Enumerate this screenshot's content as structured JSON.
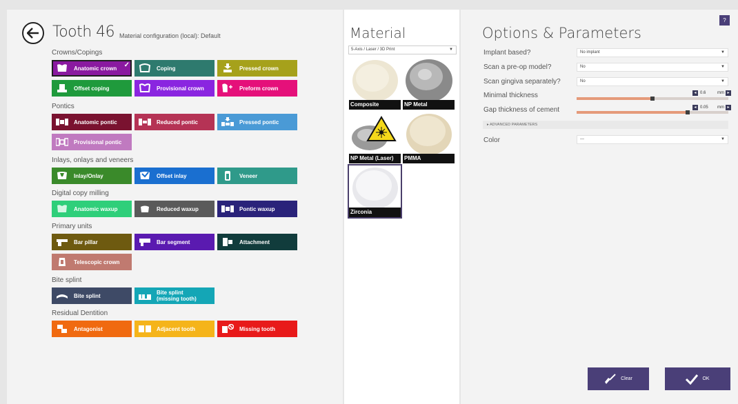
{
  "header": {
    "title": "Tooth 46",
    "subtitle": "Material configuration (local): Default"
  },
  "sections": [
    {
      "label": "Crowns/Copings"
    },
    {
      "label": "Pontics"
    },
    {
      "label": "Inlays, onlays and veneers"
    },
    {
      "label": "Digital copy milling"
    },
    {
      "label": "Primary units"
    },
    {
      "label": "Bite splint"
    },
    {
      "label": "Residual Dentition"
    }
  ],
  "tiles": {
    "anatomic_crown": {
      "label": "Anatomic crown",
      "color": "#8a1aa0"
    },
    "coping": {
      "label": "Coping",
      "color": "#2e7a6e"
    },
    "pressed_crown": {
      "label": "Pressed crown",
      "color": "#a6a11b"
    },
    "offset_coping": {
      "label": "Offset coping",
      "color": "#1f9a3c"
    },
    "provisional_crown": {
      "label": "Provisional crown",
      "color": "#8a25e0"
    },
    "preform_crown": {
      "label": "Preform crown",
      "color": "#e5107a"
    },
    "anatomic_pontic": {
      "label": "Anatomic pontic",
      "color": "#7a1230"
    },
    "reduced_pontic": {
      "label": "Reduced pontic",
      "color": "#b53355"
    },
    "pressed_pontic": {
      "label": "Pressed pontic",
      "color": "#4a9ad6"
    },
    "provisional_pontic": {
      "label": "Provisional pontic",
      "color": "#c07ac0"
    },
    "inlay_onlay": {
      "label": "Inlay/Onlay",
      "color": "#3a8a2a"
    },
    "offset_inlay": {
      "label": "Offset inlay",
      "color": "#1a6fd0"
    },
    "veneer": {
      "label": "Veneer",
      "color": "#2f9a8a"
    },
    "anatomic_waxup": {
      "label": "Anatomic waxup",
      "color": "#2fcf7a"
    },
    "reduced_waxup": {
      "label": "Reduced waxup",
      "color": "#5a5a5a"
    },
    "pontic_waxup": {
      "label": "Pontic waxup",
      "color": "#2a237a"
    },
    "bar_pillar": {
      "label": "Bar pillar",
      "color": "#6e5a10"
    },
    "bar_segment": {
      "label": "Bar segment",
      "color": "#5a1ab0"
    },
    "attachment": {
      "label": "Attachment",
      "color": "#113c3c"
    },
    "telescopic_crown": {
      "label": "Telescopic crown",
      "color": "#c07a70"
    },
    "bite_splint": {
      "label": "Bite splint",
      "color": "#3e4a66"
    },
    "bite_splint_missing": {
      "label": "Bite splint\n(missing tooth)",
      "label_line1": "Bite splint",
      "label_line2": "(missing tooth)",
      "color": "#14a6b6"
    },
    "antagonist": {
      "label": "Antagonist",
      "color": "#f06a10"
    },
    "adjacent_tooth": {
      "label": "Adjacent tooth",
      "color": "#f5b41a"
    },
    "missing_tooth": {
      "label": "Missing tooth",
      "color": "#e81a1a"
    }
  },
  "material": {
    "title": "Material",
    "filter": "5-Axis / Laser / 3D Print",
    "cards": [
      {
        "name": "Composite"
      },
      {
        "name": "NP Metal"
      },
      {
        "name": "NP Metal (Laser)"
      },
      {
        "name": "PMMA"
      },
      {
        "name": "Zirconia",
        "selected": true
      }
    ]
  },
  "options": {
    "title": "Options & Parameters",
    "help_label": "?",
    "implant_based": {
      "label": "Implant based?",
      "value": "No implant"
    },
    "scan_preop": {
      "label": "Scan a pre-op model?",
      "value": "No"
    },
    "scan_gingiva": {
      "label": "Scan gingiva separately?",
      "value": "No"
    },
    "minimal_thickness": {
      "label": "Minimal thickness",
      "value": "0.6",
      "unit": "mm",
      "fraction": 0.5
    },
    "gap_thickness": {
      "label": "Gap thickness of cement",
      "value": "0.05",
      "unit": "mm",
      "fraction": 0.73
    },
    "advanced_label": "ADVANCED PARAMETERS",
    "color": {
      "label": "Color",
      "value": "---"
    }
  },
  "actions": {
    "clear_label": "Clear",
    "ok_label": "OK"
  }
}
